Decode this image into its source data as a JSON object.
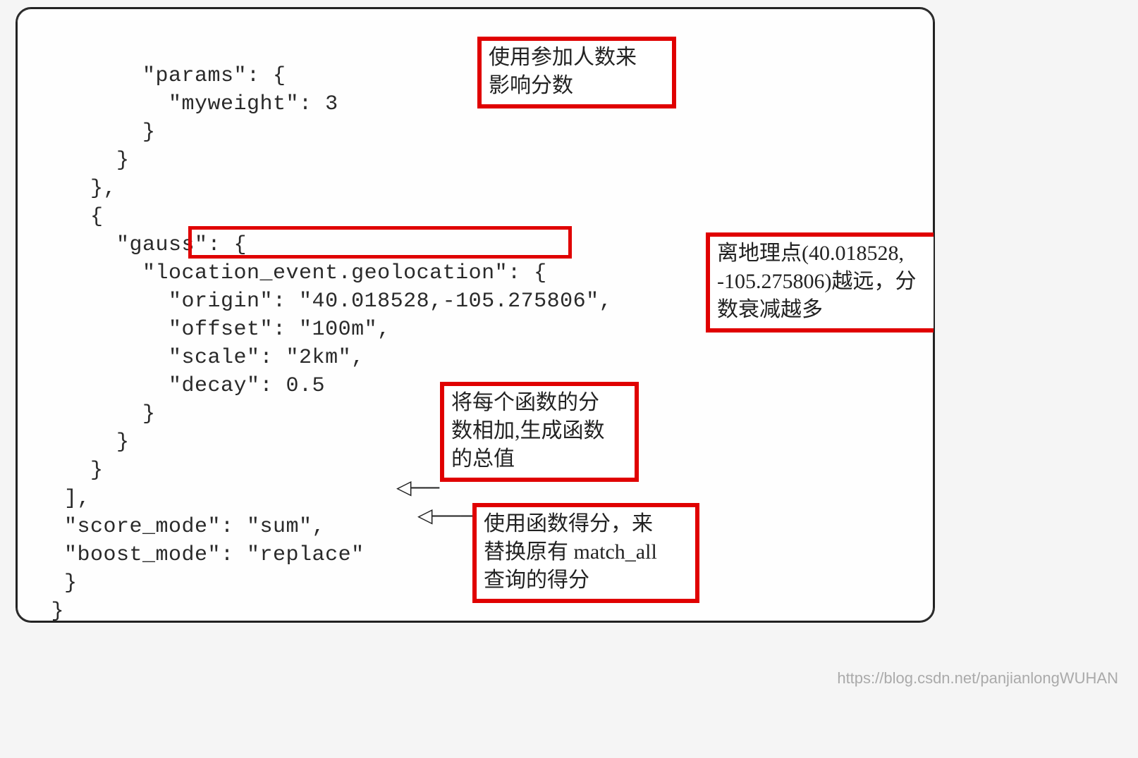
{
  "code": {
    "l1": "        \"params\": {",
    "l2": "          \"myweight\": 3",
    "l3": "        }",
    "l4": "      }",
    "l5": "    },",
    "l6": "    {",
    "l7": "      \"gauss\": {",
    "l8": "        \"location_event.geolocation\": {",
    "l9": "          \"origin\": \"40.018528,-105.275806\",",
    "l10": "          \"offset\": \"100m\",",
    "l11": "          \"scale\": \"2km\",",
    "l12": "          \"decay\": 0.5",
    "l13": "        }",
    "l14": "      }",
    "l15": "    }",
    "l16": "  ],",
    "l17": "  \"score_mode\": \"sum\",",
    "l18": "  \"boost_mode\": \"replace\"",
    "l19": "  }",
    "l20": " }",
    "l21": "}'"
  },
  "annotations": {
    "a1_line1": "使用参加人数来",
    "a1_line2": "影响分数",
    "a2_line1": "离地理点(40.018528,",
    "a2_line2": "-105.275806)越远，分",
    "a2_line3": "数衰减越多",
    "a3_line1": "将每个函数的分",
    "a3_line2": "数相加,生成函数",
    "a3_line3": "的总值",
    "a4_line1": "使用函数得分，来",
    "a4_line2": "替换原有 match_all",
    "a4_line3": "查询的得分"
  },
  "arrows": {
    "left1": "◁──",
    "left2": "◁───"
  },
  "watermark": "https://blog.csdn.net/panjianlongWUHAN"
}
